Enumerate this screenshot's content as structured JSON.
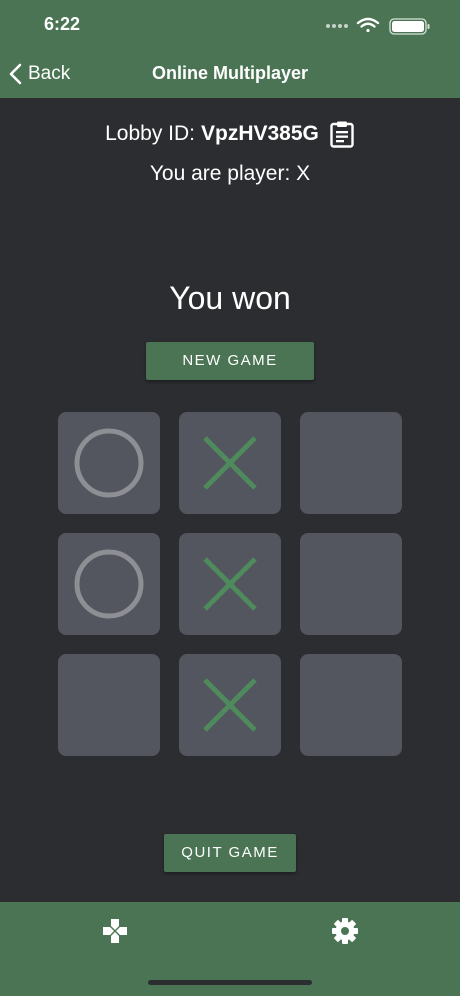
{
  "status_bar": {
    "time": "6:22"
  },
  "nav": {
    "back_label": "Back",
    "title": "Online Multiplayer"
  },
  "lobby": {
    "label": "Lobby ID:",
    "id": "VpzHV385G"
  },
  "player": {
    "text": "You are player: X"
  },
  "result": {
    "text": "You won"
  },
  "buttons": {
    "new_game": "NEW GAME",
    "quit_game": "QUIT GAME"
  },
  "board": {
    "cells": [
      "O",
      "X",
      "",
      "O",
      "X",
      "",
      "",
      "X",
      ""
    ]
  },
  "colors": {
    "accent": "#4a7453",
    "background": "#2b2d31",
    "cell": "#53555f",
    "x_mark": "#4f8a5c",
    "o_mark": "#8e8f95"
  },
  "tabs": [
    {
      "icon": "gamepad-icon"
    },
    {
      "icon": "gear-icon"
    }
  ]
}
